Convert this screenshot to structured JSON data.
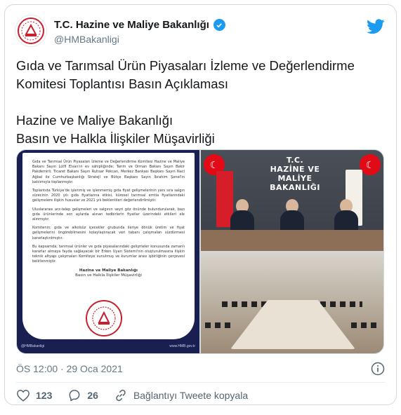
{
  "account": {
    "name": "T.C. Hazine ve Maliye Bakanlığı",
    "handle": "@HMBakanligi"
  },
  "tweet": {
    "text": "Gıda ve Tarımsal Ürün Piyasaları İzleme ve Değerlendirme Komitesi Toplantısı Basın Açıklaması\n\nHazine ve Maliye Bakanlığı\nBasın ve Halkla İlişkiler Müşavirliği",
    "timestamp": "ÖS 12:00 · 29 Oca 2021"
  },
  "press_release": {
    "paragraphs": [
      "Gıda ve Tarımsal Ürün Piyasaları İzleme ve Değerlendirme Komitesi Hazine ve Maliye Bakanı Sayın Lütfi Elvan'ın ev sahipliğinde; Tarım ve Orman Bakanı Sayın Bekir Pakdemirli, Ticaret Bakanı Sayın Ruhsar Pekcan, Merkez Bankası Başkanı Sayın Naci Ağbal ile Cumhurbaşkanlığı Strateji ve Bütçe Başkanı Sayın İbrahim Şenel'in katılımıyla toplanmıştır.",
      "Toplantıda Türkiye'de işlenmiş ve işlenmemiş gıda fiyat gelişmelerinin yanı sıra salgın sürecinin 2020 yılı gıda fiyatlarına etkisi, küresel tarımsal emtia fiyatlarındaki gelişmelere ilişkin hususlar ve 2021 yılı beklentileri değerlendirilmiştir.",
      "Uluslararası arz-talep gelişmeleri ve salgının seyri göz önünde bulundurularak, bazı gıda ürünlerinde son aylarda alınan tedbirlerin fiyatlar üzerindeki etkileri ele alınmıştır.",
      "Komitenin; gıda ve alkolsüz içecekler grubunda ileriye dönük üretim ve fiyat gelişmelerini öngörebilmesini kolaylaştıracak veri tabanı çalışmaları sürdürmesi kararlaştırılmıştır.",
      "Bu kapsamda; tarımsal ürünler ve gıda piyasalarındaki gelişmeler konusunda zamanlı kararlar almaya fayda sağlayacak bir Erken Uyarı Sistemi'nin oluşturulmasına ilişkin teknik altyapı çalışmaları Komiteye sunulmuş ve kurumlar arası işbirliğinin çerçevesi belirlenmiştir."
    ],
    "signature_org": "Hazine ve Maliye Bakanlığı",
    "signature_unit": "Basın ve Halkla İlişkiler Müşavirliği",
    "footer_handle": "@HMBakanligi",
    "footer_url": "www.HMB.gov.tr"
  },
  "photo": {
    "wall_sign_line1": "T.C.",
    "wall_sign_line2": "HAZİNE VE MALİYE",
    "wall_sign_line3": "BAKANLIĞI"
  },
  "actions": {
    "likes": "123",
    "replies": "26",
    "copy_link": "Bağlantıyı Tweete kopyala"
  },
  "colors": {
    "accent": "#1d9bf0",
    "like": "#536471",
    "brand_red": "#c8202f",
    "press_bg": "#1a1f52"
  },
  "icons": [
    "twitter-bird-icon",
    "verified-badge-icon",
    "info-icon",
    "heart-icon",
    "reply-icon",
    "link-icon"
  ]
}
